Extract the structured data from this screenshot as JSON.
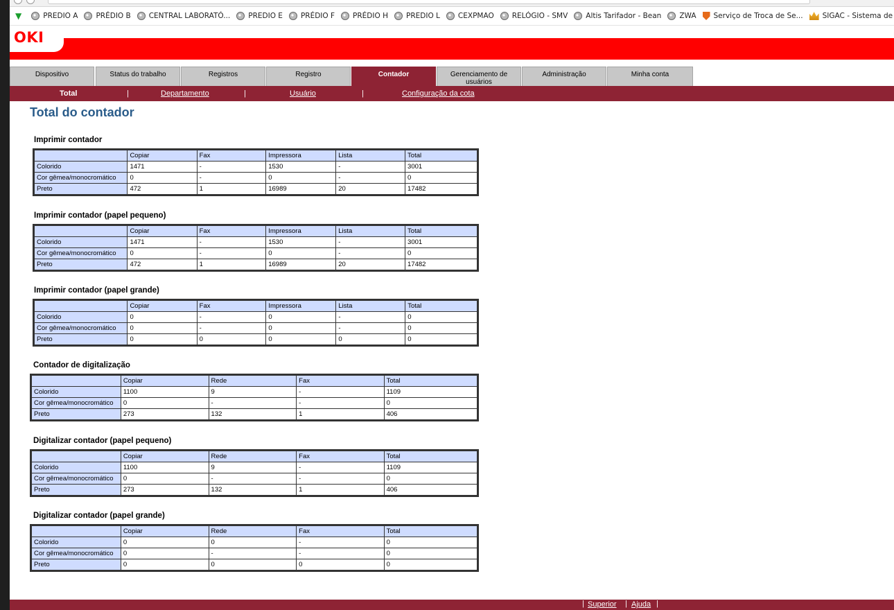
{
  "bookmarks": [
    {
      "label": "PREDIO A",
      "icon": "globe-icon"
    },
    {
      "label": "PRÉDIO B",
      "icon": "globe-icon"
    },
    {
      "label": "CENTRAL LABORATÓ...",
      "icon": "globe-icon"
    },
    {
      "label": "PREDIO E",
      "icon": "globe-icon"
    },
    {
      "label": "PRÉDIO F",
      "icon": "globe-icon"
    },
    {
      "label": "PRÉDIO H",
      "icon": "globe-icon"
    },
    {
      "label": "PREDIO L",
      "icon": "globe-icon"
    },
    {
      "label": "CEXPMAO",
      "icon": "globe-icon"
    },
    {
      "label": "RELÓGIO - SMV",
      "icon": "globe-icon"
    },
    {
      "label": "Altis Tarifador - Bean",
      "icon": "globe-icon"
    },
    {
      "label": "ZWA",
      "icon": "globe-icon"
    },
    {
      "label": "Serviço de Troca de Se...",
      "icon": "shield-icon"
    },
    {
      "label": "SIGAC - Sistema de Ge...",
      "icon": "crown-icon"
    }
  ],
  "header": {
    "logo": "OKI",
    "brand_color": "#ff0000"
  },
  "tabs": [
    {
      "label": "Dispositivo"
    },
    {
      "label": "Status do trabalho"
    },
    {
      "label": "Registros"
    },
    {
      "label": "Registro"
    },
    {
      "label": "Contador"
    },
    {
      "label": "Gerenciamento de usuários"
    },
    {
      "label": "Administração"
    },
    {
      "label": "Minha conta"
    }
  ],
  "subnav": {
    "current": "Total",
    "links": [
      "Departamento",
      "Usuário",
      "Configuração da cota"
    ],
    "sep": "|"
  },
  "page_title": "Total do contador",
  "row_labels": [
    "Colorido",
    "Cor gêmea/monocromático",
    "Preto"
  ],
  "sections": [
    {
      "title": "Imprimir contador",
      "headers": [
        "Copiar",
        "Fax",
        "Impressora",
        "Lista",
        "Total"
      ],
      "rows": [
        [
          "1471",
          "-",
          "1530",
          "-",
          "3001"
        ],
        [
          "0",
          "-",
          "0",
          "-",
          "0"
        ],
        [
          "472",
          "1",
          "16989",
          "20",
          "17482"
        ]
      ]
    },
    {
      "title": "Imprimir contador (papel pequeno)",
      "headers": [
        "Copiar",
        "Fax",
        "Impressora",
        "Lista",
        "Total"
      ],
      "rows": [
        [
          "1471",
          "-",
          "1530",
          "-",
          "3001"
        ],
        [
          "0",
          "-",
          "0",
          "-",
          "0"
        ],
        [
          "472",
          "1",
          "16989",
          "20",
          "17482"
        ]
      ]
    },
    {
      "title": "Imprimir contador (papel grande)",
      "headers": [
        "Copiar",
        "Fax",
        "Impressora",
        "Lista",
        "Total"
      ],
      "rows": [
        [
          "0",
          "-",
          "0",
          "-",
          "0"
        ],
        [
          "0",
          "-",
          "0",
          "-",
          "0"
        ],
        [
          "0",
          "0",
          "0",
          "0",
          "0"
        ]
      ]
    },
    {
      "title": "Contador de digitalização",
      "headers": [
        "Copiar",
        "Rede",
        "Fax",
        "Total"
      ],
      "rows": [
        [
          "1100",
          "9",
          "-",
          "1109"
        ],
        [
          "0",
          "-",
          "-",
          "0"
        ],
        [
          "273",
          "132",
          "1",
          "406"
        ]
      ]
    },
    {
      "title": "Digitalizar contador (papel pequeno)",
      "headers": [
        "Copiar",
        "Rede",
        "Fax",
        "Total"
      ],
      "rows": [
        [
          "1100",
          "9",
          "-",
          "1109"
        ],
        [
          "0",
          "-",
          "-",
          "0"
        ],
        [
          "273",
          "132",
          "1",
          "406"
        ]
      ]
    },
    {
      "title": "Digitalizar contador (papel grande)",
      "headers": [
        "Copiar",
        "Rede",
        "Fax",
        "Total"
      ],
      "rows": [
        [
          "0",
          "0",
          "-",
          "0"
        ],
        [
          "0",
          "-",
          "-",
          "0"
        ],
        [
          "0",
          "0",
          "0",
          "0"
        ]
      ]
    }
  ],
  "footer": {
    "links": [
      "Superior",
      "Ajuda"
    ],
    "sep": "|"
  },
  "colors": {
    "accent": "#8e2334",
    "table_header": "#cfdcff",
    "title": "#2a5c8a"
  }
}
